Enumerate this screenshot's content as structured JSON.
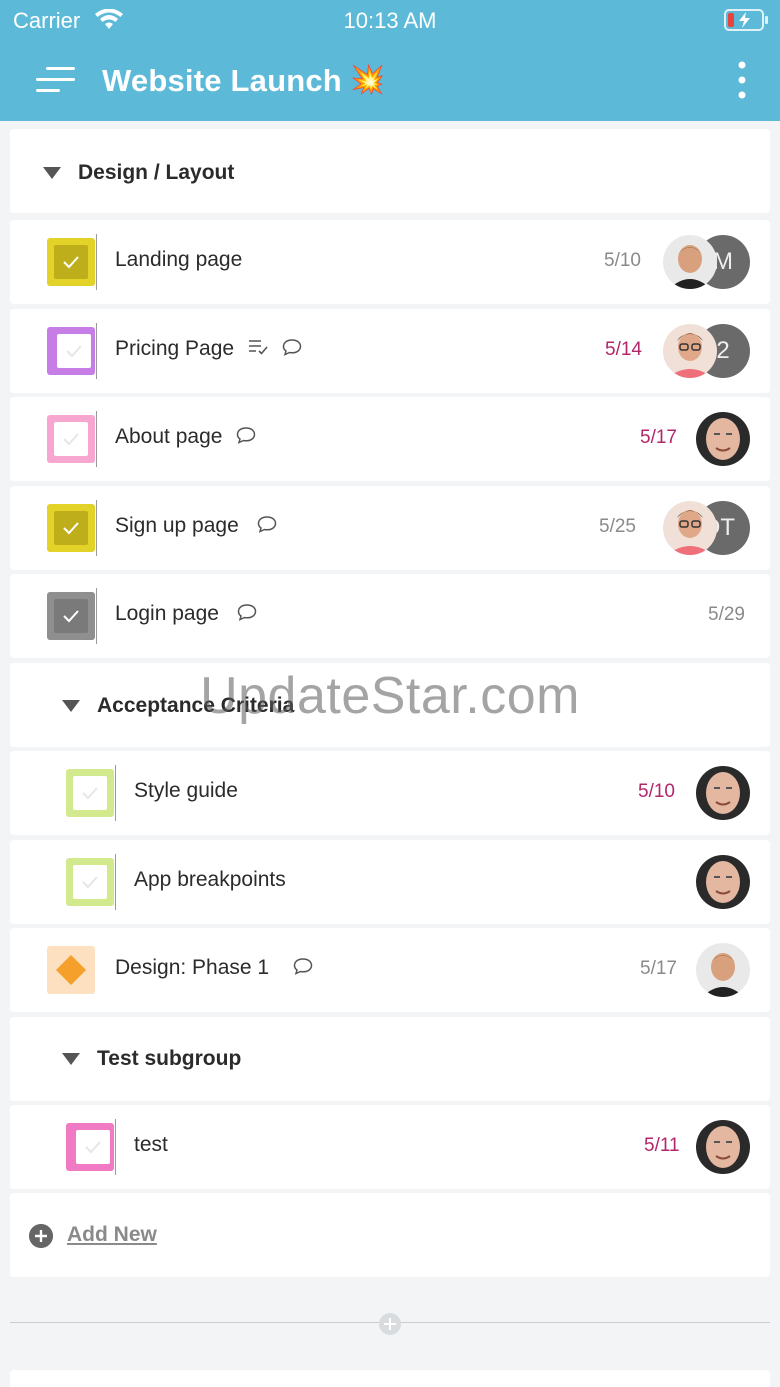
{
  "status_bar": {
    "carrier": "Carrier",
    "time": "10:13 AM"
  },
  "header": {
    "title": "Website Launch",
    "emoji": "💥",
    "menu_icon": "hamburger-menu-icon",
    "more_icon": "more-vertical-icon"
  },
  "groups": [
    {
      "title": "Design / Layout"
    },
    {
      "title": "Acceptance Criteria"
    },
    {
      "title": "Test subgroup"
    }
  ],
  "tasks": [
    {
      "label": "Landing page",
      "date": "5/10",
      "overdue": false,
      "status_color": "#e3d228",
      "done": true,
      "avatar_initials": "M"
    },
    {
      "label": "Pricing Page",
      "date": "5/14",
      "overdue": true,
      "status_color": "#c77de6",
      "done": false,
      "avatar_initials": "2"
    },
    {
      "label": "About page",
      "date": "5/17",
      "overdue": true,
      "status_color": "#f6a6cf",
      "done": false
    },
    {
      "label": "Sign up page",
      "date": "5/25",
      "overdue": false,
      "status_color": "#e3d228",
      "done": true,
      "avatar_initials": "DT"
    },
    {
      "label": "Login page",
      "date": "5/29",
      "overdue": false,
      "status_color": "#8f8f8f",
      "done": true
    },
    {
      "label": "Style guide",
      "date": "5/10",
      "overdue": true,
      "status_color": "#d2e98d",
      "done": false
    },
    {
      "label": "App breakpoints",
      "date": "",
      "overdue": false,
      "status_color": "#d2e98d",
      "done": false
    },
    {
      "label": "Design: Phase 1",
      "date": "5/17",
      "overdue": false,
      "status_color": "#f5a02a",
      "milestone": true
    },
    {
      "label": "test",
      "date": "5/11",
      "overdue": true,
      "status_color": "#f07ac4",
      "done": false
    }
  ],
  "add_new": {
    "label": "Add New"
  },
  "watermark": "UpdateStar.com",
  "colors": {
    "header": "#5cbad8",
    "overdue": "#b2266a",
    "background": "#f2f4f6"
  }
}
